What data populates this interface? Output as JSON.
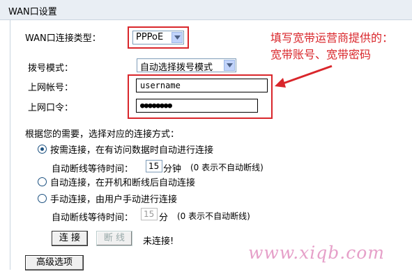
{
  "header": {
    "title": "WAN口设置"
  },
  "wan_type": {
    "label": "WAN口连接类型：",
    "value": "PPPoE"
  },
  "dial_mode": {
    "label": "拨号模式：",
    "value": "自动选择拨号模式"
  },
  "account": {
    "label": "上网帐号：",
    "value": "username"
  },
  "password": {
    "label": "上网口令：",
    "masked_value": "●●●●●●●●"
  },
  "annotation": {
    "line1": "填写宽带运营商提供的：",
    "line2": "宽带账号、宽带密码"
  },
  "connection_mode": {
    "title": "根据您的需要，选择对应的连接方式：",
    "on_demand": {
      "label": "按需连接，在有访问数据时自动进行连接",
      "selected": true
    },
    "idle1": {
      "label": "自动断线等待时间：",
      "value": "15",
      "unit": "分钟",
      "note": "(0 表示不自动断线)"
    },
    "auto": {
      "label": "自动连接，在开机和断线后自动连接",
      "selected": false
    },
    "manual": {
      "label": "手动连接，由用户手动进行连接",
      "selected": false
    },
    "idle2": {
      "label": "自动断线等待时间：",
      "value": "15",
      "unit": "分",
      "note": "(0 表示不自动断线)"
    }
  },
  "buttons": {
    "connect": "连 接",
    "disconnect": "断 线",
    "status": "未连接!",
    "advanced": "高级选项"
  },
  "watermark": "www.xiqb.com",
  "colors": {
    "annotation_red": "#d9262b",
    "header_bg": "#e9eef4",
    "watermark": "#e6a0c9"
  }
}
